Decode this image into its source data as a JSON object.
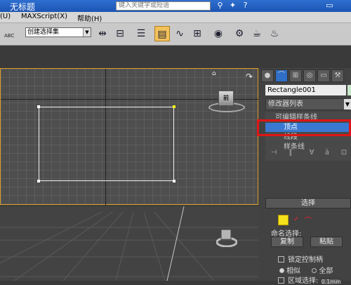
{
  "window": {
    "title": "无标题",
    "search_placeholder": "键入关键字或短语",
    "icons": [
      "binoculars-icon",
      "star-icon",
      "help-icon",
      "minimize-icon"
    ]
  },
  "menubar": {
    "items": [
      "(U)",
      "MAXScript(X)",
      "帮助(H)"
    ]
  },
  "toolbar": {
    "abc_label": "ABC",
    "selection_set_label": "创建选择集",
    "tools": [
      "mirror-icon",
      "align-icon",
      "layer-icon",
      "scene-explorer-icon",
      "curve-editor-icon",
      "schematic-icon",
      "material-editor-icon",
      "render-setup-icon",
      "render-frame-icon",
      "render-icon"
    ]
  },
  "viewport_top": {
    "viewcube_label": "前"
  },
  "command_panel": {
    "object_name": "Rectangle001",
    "modifier_list_label": "修改器列表",
    "stack_items": [
      {
        "label": "可编辑样条线",
        "selected": false
      },
      {
        "label": "顶点",
        "selected": true
      },
      {
        "label": "线段",
        "selected": false
      },
      {
        "label": "样条线",
        "selected": false
      }
    ],
    "rollout": {
      "title": "选择",
      "named_selection_label": "命名选择:",
      "copy_label": "复制",
      "paste_label": "粘贴",
      "lock_handles_label": "锁定控制柄",
      "alike_label": "相似",
      "all_label": "全部",
      "area_select_label": "区域选择:",
      "area_select_value": "0.1mm"
    }
  },
  "colors": {
    "accent_blue": "#3a79d1",
    "vertex_yellow": "#f5e11c",
    "highlight_red": "#e01515"
  }
}
